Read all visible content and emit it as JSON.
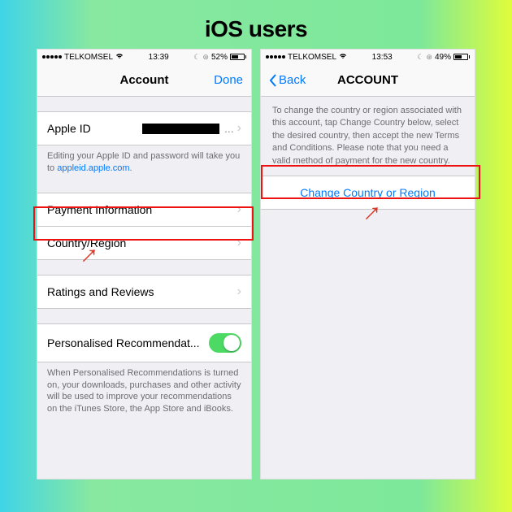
{
  "heading": "iOS users",
  "left": {
    "status": {
      "carrier": "TELKOMSEL",
      "time": "13:39",
      "battery": "52%",
      "signal_dots": 5,
      "battery_fill_pct": 52
    },
    "nav": {
      "title": "Account",
      "done": "Done"
    },
    "apple_id": {
      "label": "Apple ID",
      "value_suffix": "..."
    },
    "footer_appleid_a": "Editing your Apple ID and password will take you to ",
    "footer_appleid_link": "appleid.apple.com",
    "rows": {
      "payment": "Payment Information",
      "country": "Country/Region",
      "ratings": "Ratings and Reviews",
      "personalised": "Personalised Recommendat..."
    },
    "footer_personalised": "When Personalised Recommendations is turned on, your downloads, purchases and other activity will be used to improve your recommendations on the iTunes Store, the App Store and iBooks."
  },
  "right": {
    "status": {
      "carrier": "TELKOMSEL",
      "time": "13:53",
      "battery": "49%",
      "signal_dots": 5,
      "battery_fill_pct": 49
    },
    "nav": {
      "back": "Back",
      "title": "ACCOUNT"
    },
    "desc": "To change the country or region associated with this account, tap Change Country below, select the desired country, then accept the new Terms and Conditions. Please note that you need a valid method of payment for the new country.",
    "change": "Change Country or Region"
  }
}
